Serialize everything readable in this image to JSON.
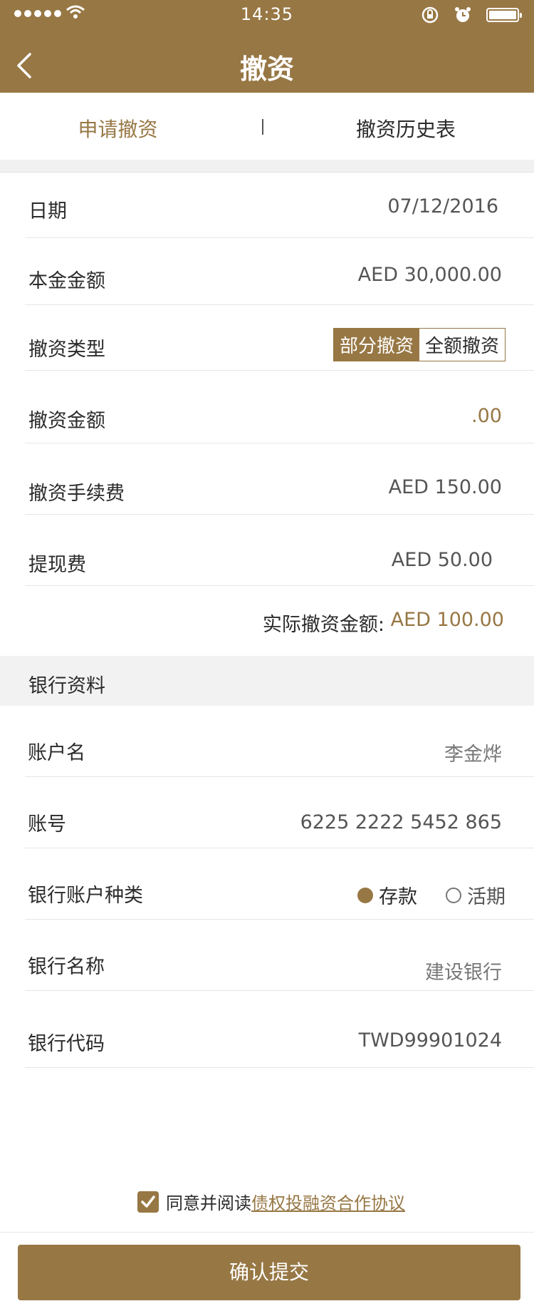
{
  "status": {
    "time": "14:35"
  },
  "header": {
    "title": "撤资"
  },
  "tabs": {
    "active": "申请撤资",
    "other": "撤资历史表"
  },
  "form": {
    "date": {
      "label": "日期",
      "value": "07/12/2016"
    },
    "principal": {
      "label": "本金金额",
      "value": "AED 30,000.00"
    },
    "type": {
      "label": "撤资类型",
      "options": [
        "部分撤资",
        "全额撤资"
      ],
      "selected": "部分撤资"
    },
    "amount": {
      "label": "撤资金额",
      "value": ".00"
    },
    "fee": {
      "label": "撤资手续费",
      "value": "AED 150.00"
    },
    "withdraw_fee": {
      "label": "提现费",
      "value": "AED 50.00"
    },
    "actual": {
      "label": "实际撤资金额:",
      "value": "AED 100.00"
    }
  },
  "bank": {
    "section_title": "银行资料",
    "account_name": {
      "label": "账户名",
      "value": "李金烨"
    },
    "account_no": {
      "label": "账号",
      "value": "6225 2222 5452 865"
    },
    "account_type": {
      "label": "银行账户种类",
      "options": [
        "存款",
        "活期"
      ],
      "selected": "存款"
    },
    "bank_name": {
      "label": "银行名称",
      "value": "建设银行"
    },
    "bank_code": {
      "label": "银行代码",
      "value": "TWD99901024"
    }
  },
  "agreement": {
    "prefix": "同意并阅读",
    "link": "债权投融资合作协议",
    "checked": true
  },
  "submit_label": "确认提交",
  "colors": {
    "brand": "#977744"
  }
}
